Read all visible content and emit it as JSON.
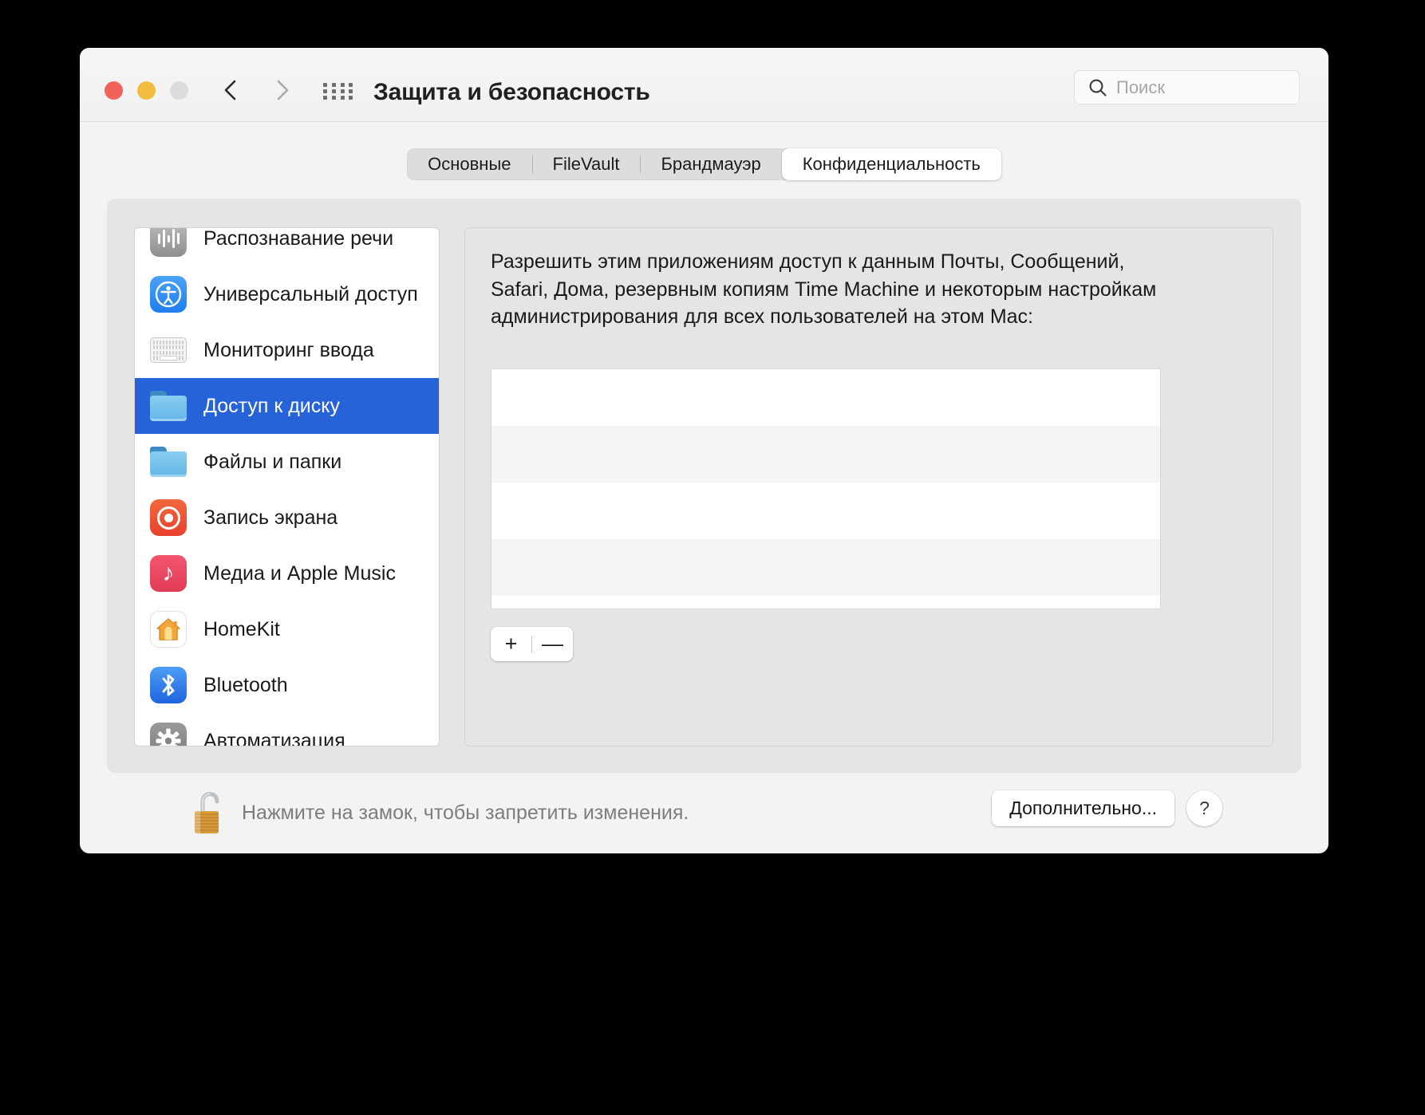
{
  "window": {
    "title": "Защита и безопасность",
    "traffic_lights": [
      "close-red",
      "minimize-yellow",
      "zoom-gray-disabled"
    ],
    "nav": {
      "back_icon": "chevron-left-icon",
      "forward_icon": "chevron-right-icon",
      "grid_icon": "show-all-grid-icon"
    }
  },
  "search": {
    "placeholder": "Поиск",
    "icon": "search-icon",
    "value": ""
  },
  "tabs": [
    {
      "label": "Основные",
      "active": false
    },
    {
      "label": "FileVault",
      "active": false
    },
    {
      "label": "Брандмауэр",
      "active": false
    },
    {
      "label": "Конфиденциальность",
      "active": true
    }
  ],
  "sidebar": {
    "items": [
      {
        "label": "Распознавание речи",
        "icon": "speech-waveform-icon",
        "selected": false
      },
      {
        "label": "Универсальный доступ",
        "icon": "accessibility-icon",
        "selected": false
      },
      {
        "label": "Мониторинг ввода",
        "icon": "keyboard-icon",
        "selected": false
      },
      {
        "label": "Доступ к диску",
        "icon": "folder-icon",
        "selected": true
      },
      {
        "label": "Файлы и папки",
        "icon": "folder-icon",
        "selected": false
      },
      {
        "label": "Запись экрана",
        "icon": "screen-record-icon",
        "selected": false
      },
      {
        "label": "Медиа и Apple Music",
        "icon": "music-note-icon",
        "selected": false
      },
      {
        "label": "HomeKit",
        "icon": "home-icon",
        "selected": false
      },
      {
        "label": "Bluetooth",
        "icon": "bluetooth-icon",
        "selected": false
      },
      {
        "label": "Автоматизация",
        "icon": "gear-icon",
        "selected": false
      }
    ]
  },
  "detail": {
    "description": "Разрешить этим приложениям доступ к данным Почты, Сообщений, Safari, Дома, резервным копиям Time Machine и некоторым настройкам администрирования для всех пользователей на этом Mac:",
    "app_list_rows": [
      "",
      "",
      "",
      ""
    ],
    "add_label": "+",
    "remove_label": "—"
  },
  "bottom": {
    "lock_icon": "unlocked-padlock-icon",
    "lock_note": "Нажмите на замок, чтобы запретить изменения.",
    "advanced_label": "Дополнительно...",
    "help_label": "?"
  },
  "colors": {
    "selection_blue": "#2663d8",
    "window_bg": "#f4f3f3",
    "panel_bg": "#e6e5e5",
    "list_alt_row": "#f4f5f5",
    "muted_text": "#7e7d7d"
  }
}
